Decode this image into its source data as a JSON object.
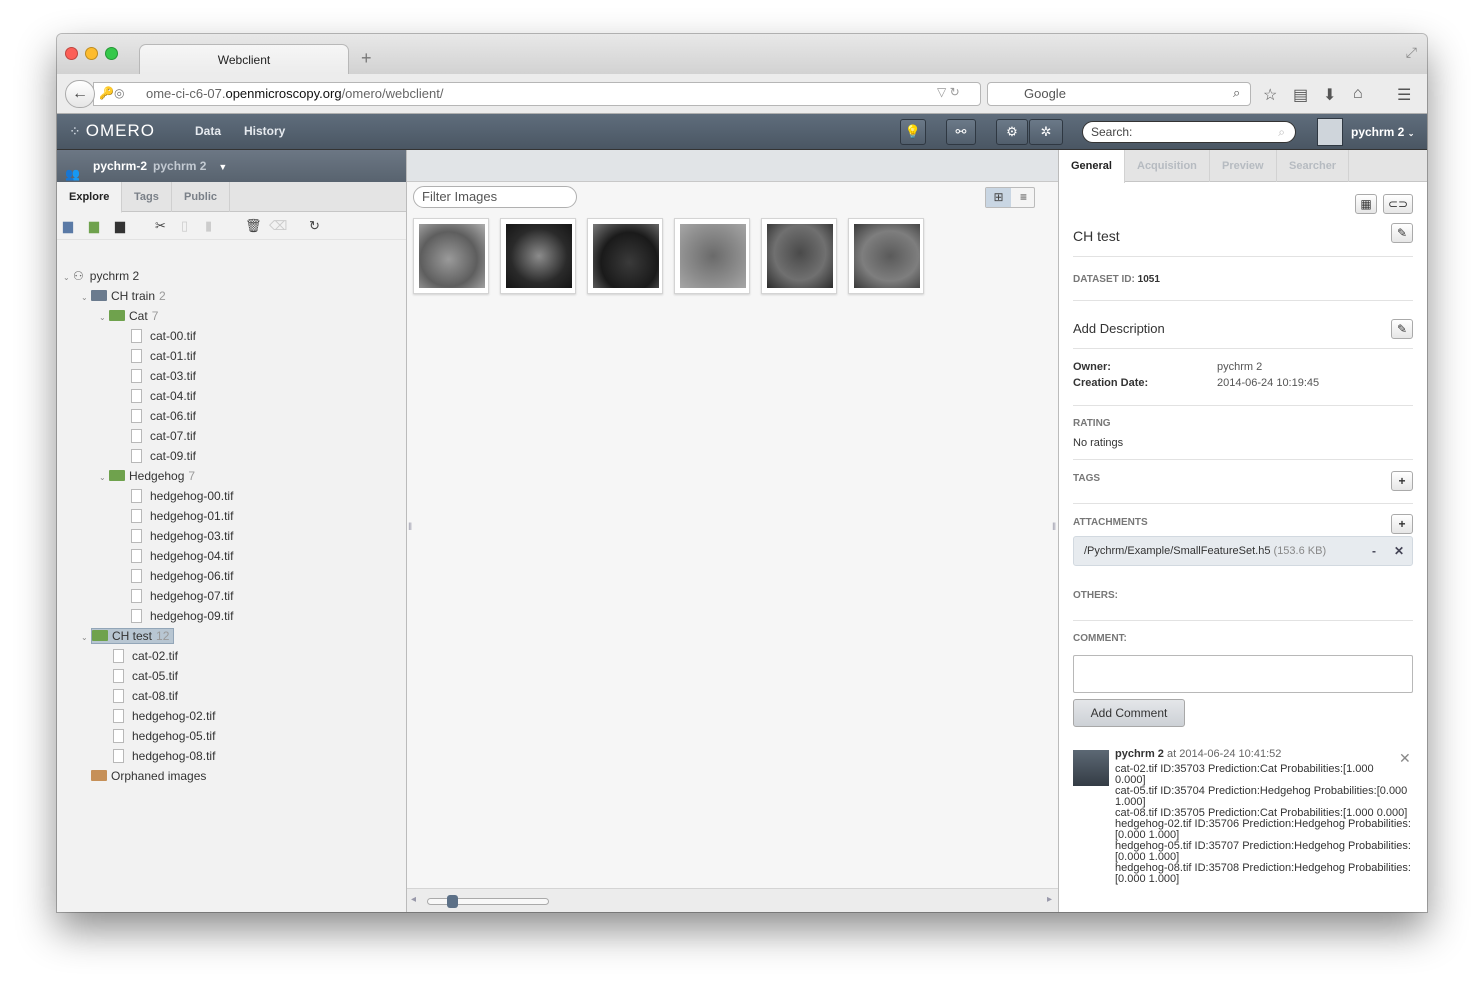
{
  "browser": {
    "tab_title": "Webclient",
    "url_prefix": "ome-ci-c6-07.",
    "url_domain": "openmicroscopy.org",
    "url_path": "/omero/webclient/",
    "search_engine": "Google"
  },
  "app": {
    "logo": "OMERO",
    "menu": [
      "Data",
      "History"
    ],
    "search_placeholder": "Search:",
    "user": "pychrm 2"
  },
  "left": {
    "group": "pychrm-2",
    "user": "pychrm 2",
    "tabs": [
      "Explore",
      "Tags",
      "Public"
    ],
    "tree": {
      "root": "pychrm 2",
      "proj1": {
        "name": "CH train",
        "count": "2"
      },
      "cat": {
        "name": "Cat",
        "count": "7",
        "files": [
          "cat-00.tif",
          "cat-01.tif",
          "cat-03.tif",
          "cat-04.tif",
          "cat-06.tif",
          "cat-07.tif",
          "cat-09.tif"
        ]
      },
      "hedgehog": {
        "name": "Hedgehog",
        "count": "7",
        "files": [
          "hedgehog-00.tif",
          "hedgehog-01.tif",
          "hedgehog-03.tif",
          "hedgehog-04.tif",
          "hedgehog-06.tif",
          "hedgehog-07.tif",
          "hedgehog-09.tif"
        ]
      },
      "chtest": {
        "name": "CH test",
        "count": "12",
        "files": [
          "cat-02.tif",
          "cat-05.tif",
          "cat-08.tif",
          "hedgehog-02.tif",
          "hedgehog-05.tif",
          "hedgehog-08.tif"
        ]
      },
      "orphaned": "Orphaned images"
    }
  },
  "center": {
    "filter_placeholder": "Filter Images"
  },
  "right": {
    "tabs": [
      "General",
      "Acquisition",
      "Preview",
      "Searcher"
    ],
    "title": "CH test",
    "dataset_label": "DATASET ID:",
    "dataset_id": "1051",
    "add_description": "Add Description",
    "owner_label": "Owner:",
    "owner": "pychrm 2",
    "date_label": "Creation Date:",
    "date": "2014-06-24 10:19:45",
    "rating_label": "RATING",
    "rating": "No ratings",
    "tags_label": "TAGS",
    "attachments_label": "ATTACHMENTS",
    "attachment_name": "/Pychrm/Example/SmallFeatureSet.h5",
    "attachment_size": "(153.6 KB)",
    "others_label": "OTHERS:",
    "comment_label": "COMMENT:",
    "add_comment": "Add Comment",
    "comment_user": "pychrm 2",
    "comment_time": "at 2014-06-24 10:41:52",
    "comment_text": "cat-02.tif ID:35703 Prediction:Cat Probabilities:[1.000\n0.000]\ncat-05.tif ID:35704 Prediction:Hedgehog Probabilities:[0.000\n1.000]\ncat-08.tif ID:35705 Prediction:Cat Probabilities:[1.000 0.000]\nhedgehog-02.tif ID:35706 Prediction:Hedgehog Probabilities:\n[0.000 1.000]\nhedgehog-05.tif ID:35707 Prediction:Hedgehog Probabilities:\n[0.000 1.000]\nhedgehog-08.tif ID:35708 Prediction:Hedgehog Probabilities:\n[0.000 1.000]"
  }
}
